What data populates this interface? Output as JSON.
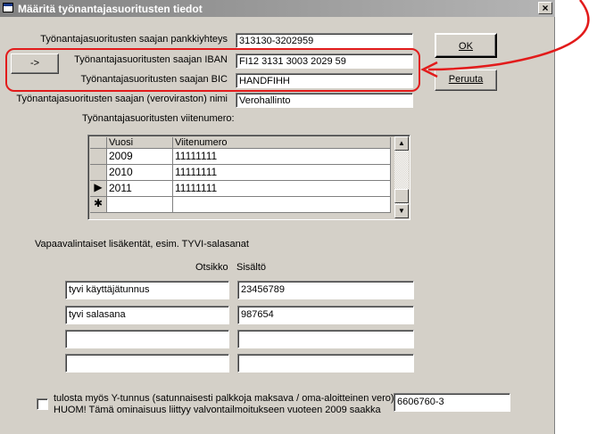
{
  "window": {
    "title": "Määritä työnantajasuoritusten tiedot",
    "close_glyph": "×"
  },
  "fields": {
    "bank_label": "Työnantajasuoritusten saajan pankkiyhteys",
    "bank_value": "313130-3202959",
    "iban_label": "Työnantajasuoritusten saajan IBAN",
    "iban_value": "FI12 3131 3003 2029 59",
    "bic_label": "Työnantajasuoritusten saajan BIC",
    "bic_value": "HANDFIHH",
    "name_label": "Työnantajasuoritusten saajan (veroviraston) nimi",
    "name_value": "Verohallinto",
    "ref_label": "Työnantajasuoritusten viitenumero:"
  },
  "buttons": {
    "convert_label": "->",
    "ok_label": "OK",
    "cancel_label": "Peruuta"
  },
  "grid": {
    "columns": [
      "Vuosi",
      "Viitenumero"
    ],
    "rows": [
      {
        "selector": "",
        "year": "2009",
        "ref": "11111111"
      },
      {
        "selector": "",
        "year": "2010",
        "ref": "11111111"
      },
      {
        "selector": "▶",
        "year": "2011",
        "ref": "11111111"
      },
      {
        "selector": "✱",
        "year": "",
        "ref": ""
      }
    ]
  },
  "extra": {
    "section_label": "Vapaavalintaiset lisäkentät, esim. TYVI-salasanat",
    "title_col": "Otsikko",
    "content_col": "Sisältö",
    "rows": [
      {
        "title": "tyvi käyttäjätunnus",
        "content": "23456789"
      },
      {
        "title": "tyvi salasana",
        "content": "987654"
      },
      {
        "title": "",
        "content": ""
      },
      {
        "title": "",
        "content": ""
      }
    ]
  },
  "ytunnus": {
    "line1": "tulosta myös Y-tunnus (satunnaisesti palkkoja maksava / oma-aloitteinen vero)",
    "line2": "HUOM! Tämä ominaisuus liittyy valvontailmoitukseen vuoteen 2009 saakka",
    "value": "6606760-3"
  },
  "annotation": {
    "color": "#e21b1b"
  }
}
